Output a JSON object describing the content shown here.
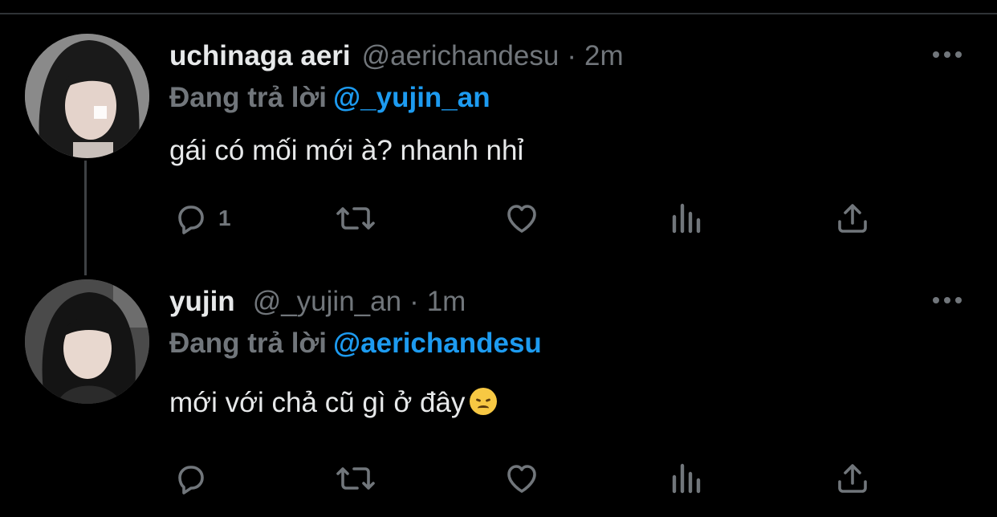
{
  "tweets": [
    {
      "name": "uchinaga aeri",
      "handle": "@aerichandesu",
      "separator": "·",
      "time": "2m",
      "replying_label": "Đang trả lời",
      "replying_to": "@_yujin_an",
      "text": "gái có mối mới à? nhanh nhỉ",
      "reply_count": "1",
      "icons": [
        "reply-icon",
        "retweet-icon",
        "like-icon",
        "analytics-icon",
        "share-icon",
        "more-icon"
      ]
    },
    {
      "name": "yujin",
      "handle": "@_yujin_an",
      "separator": "·",
      "time": "1m",
      "replying_label": "Đang trả lời",
      "replying_to": "@aerichandesu",
      "text": "mới với chả cũ gì ở đây",
      "emoji": "disappointed-face-emoji",
      "reply_count": "",
      "icons": [
        "reply-icon",
        "retweet-icon",
        "like-icon",
        "analytics-icon",
        "share-icon",
        "more-icon"
      ]
    }
  ],
  "colors": {
    "background": "#000000",
    "text": "#e7e9ea",
    "secondary": "#71767b",
    "accent": "#1d9bf0"
  }
}
